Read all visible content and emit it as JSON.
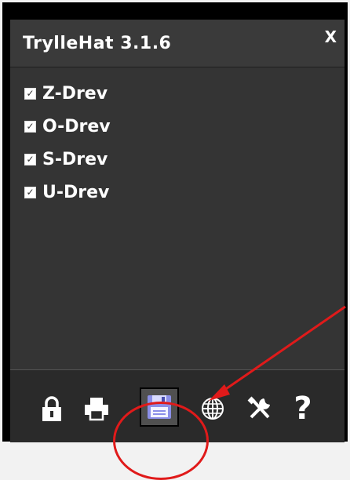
{
  "window": {
    "title": "TrylleHat 3.1.6",
    "close_label": "X"
  },
  "drives": [
    {
      "label": "Z-Drev",
      "checked": true
    },
    {
      "label": "O-Drev",
      "checked": true
    },
    {
      "label": "S-Drev",
      "checked": true
    },
    {
      "label": "U-Drev",
      "checked": true
    }
  ],
  "toolbar": {
    "items": [
      {
        "icon": "lock-icon"
      },
      {
        "icon": "printer-icon"
      },
      {
        "icon": "save-icon",
        "active": true
      },
      {
        "icon": "globe-icon"
      },
      {
        "icon": "tools-icon"
      },
      {
        "icon": "help-icon",
        "label": "?"
      }
    ]
  },
  "annotation": {
    "color": "#e01a1a"
  },
  "colors": {
    "panel": "#343434",
    "title_bar": "#3a3a3a",
    "save_icon": "#8b8fe8"
  }
}
